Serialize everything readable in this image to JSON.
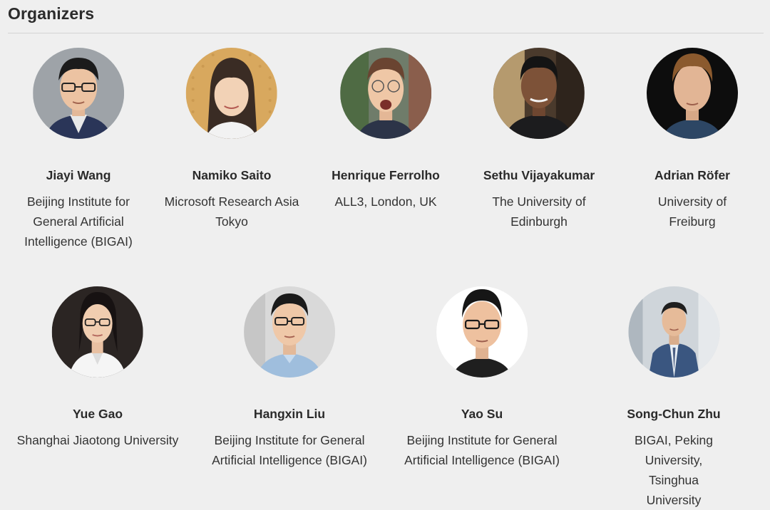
{
  "section": {
    "title": "Organizers"
  },
  "organizers_row1": [
    {
      "name": "Jiayi Wang",
      "affiliation_lines": [
        "Beijing Institute for",
        "General Artificial",
        "Intelligence (BIGAI)"
      ]
    },
    {
      "name": "Namiko Saito",
      "affiliation_lines": [
        "Microsoft Research Asia",
        "Tokyo"
      ]
    },
    {
      "name": "Henrique Ferrolho",
      "affiliation_lines": [
        "ALL3, London, UK"
      ]
    },
    {
      "name": "Sethu Vijayakumar",
      "affiliation_lines": [
        "The University of",
        "Edinburgh"
      ]
    },
    {
      "name": "Adrian Röfer",
      "affiliation_lines": [
        "University of Freiburg"
      ]
    }
  ],
  "organizers_row2": [
    {
      "name": "Yue Gao",
      "affiliation_lines": [
        "Shanghai Jiaotong University"
      ]
    },
    {
      "name": "Hangxin Liu",
      "affiliation_lines": [
        "Beijing Institute for General",
        "Artificial Intelligence (BIGAI)"
      ]
    },
    {
      "name": "Yao Su",
      "affiliation_lines": [
        "Beijing Institute for General",
        "Artificial Intelligence (BIGAI)"
      ]
    },
    {
      "name": "Song-Chun Zhu",
      "affiliation_lines": [
        "BIGAI, Peking University,",
        "Tsinghua University"
      ]
    }
  ],
  "colors": {
    "page_background": "#efefef",
    "divider": "#d4d4d4"
  }
}
